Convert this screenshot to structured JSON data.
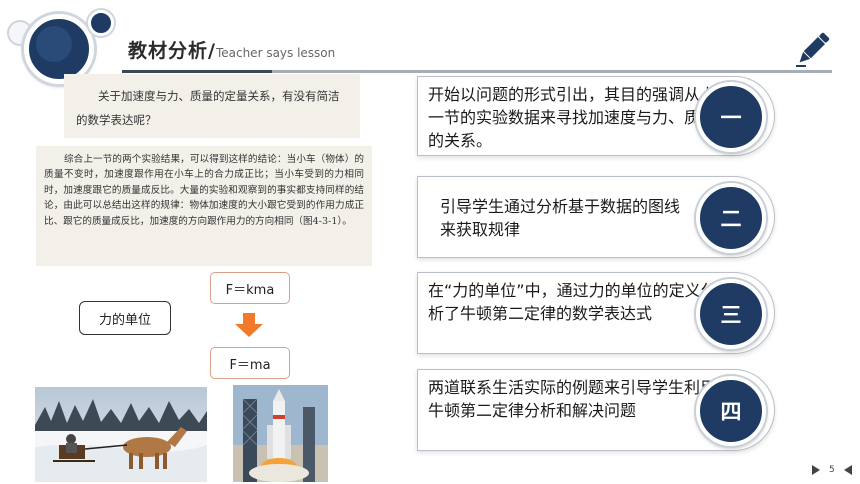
{
  "header": {
    "title": "教材分析/",
    "subtitle": "Teacher says lesson",
    "accent_color": "#1f3b63",
    "icon": "pen-icon"
  },
  "textbook": {
    "question": "关于加速度与力、质量的定量关系，有没有简洁的数学表达呢？",
    "conclusion": "综合上一节的两个实验结果，可以得到这样的结论：当小车（物体）的质量不变时，加速度跟作用在小车上的合力成正比；当小车受到的力相同时，加速度跟它的质量成反比。大量的实验和观察到的事实都支持同样的结论，由此可以总结出这样的规律：物体加速度的大小跟它受到的作用力成正比、跟它的质量成反比，加速度的方向跟作用力的方向相同（图4-3-1）。"
  },
  "formulas": {
    "f1": "F＝kma",
    "f2": "F＝ma",
    "unit_label": "力的单位",
    "arrow_color": "#f07a2a"
  },
  "panels": [
    {
      "text": "开始以问题的形式引出，其目的强调从上一节的实验数据来寻找加速度与力、质量的关系。",
      "badge": "一"
    },
    {
      "text": "引导学生通过分析基于数据的图线来获取规律",
      "badge": "二"
    },
    {
      "text": "在“力的单位”中，通过力的单位的定义分析了牛顿第二定律的数学表达式",
      "badge": "三"
    },
    {
      "text": "两道联系生活实际的例题来引导学生利用牛顿第二定律分析和解决问题",
      "badge": "四"
    }
  ],
  "footer": {
    "page_number": "5"
  }
}
